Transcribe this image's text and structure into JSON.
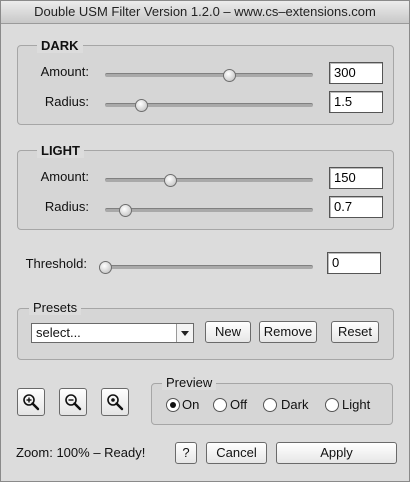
{
  "window": {
    "title": "Double USM Filter Version 1.2.0 – www.cs–extensions.com"
  },
  "dark": {
    "title": "DARK",
    "amount": {
      "label": "Amount:",
      "value": "300",
      "slider_fraction": 0.6
    },
    "radius": {
      "label": "Radius:",
      "value": "1.5",
      "slider_fraction": 0.15
    }
  },
  "light": {
    "title": "LIGHT",
    "amount": {
      "label": "Amount:",
      "value": "150",
      "slider_fraction": 0.3
    },
    "radius": {
      "label": "Radius:",
      "value": "0.7",
      "slider_fraction": 0.07
    }
  },
  "threshold": {
    "label": "Threshold:",
    "value": "0",
    "slider_fraction": 0.0
  },
  "presets": {
    "title": "Presets",
    "selected": "select...",
    "new_label": "New",
    "remove_label": "Remove",
    "reset_label": "Reset"
  },
  "zoom_buttons": {
    "zoom_in_icon": "zoom-in-icon",
    "zoom_out_icon": "zoom-out-icon",
    "zoom_fit_icon": "zoom-actual-icon"
  },
  "preview": {
    "title": "Preview",
    "options": [
      {
        "label": "On",
        "checked": true
      },
      {
        "label": "Off",
        "checked": false
      },
      {
        "label": "Dark",
        "checked": false
      },
      {
        "label": "Light",
        "checked": false
      }
    ]
  },
  "status": {
    "text": "Zoom: 100% – Ready!"
  },
  "footer": {
    "help_label": "?",
    "cancel_label": "Cancel",
    "apply_label": "Apply"
  }
}
